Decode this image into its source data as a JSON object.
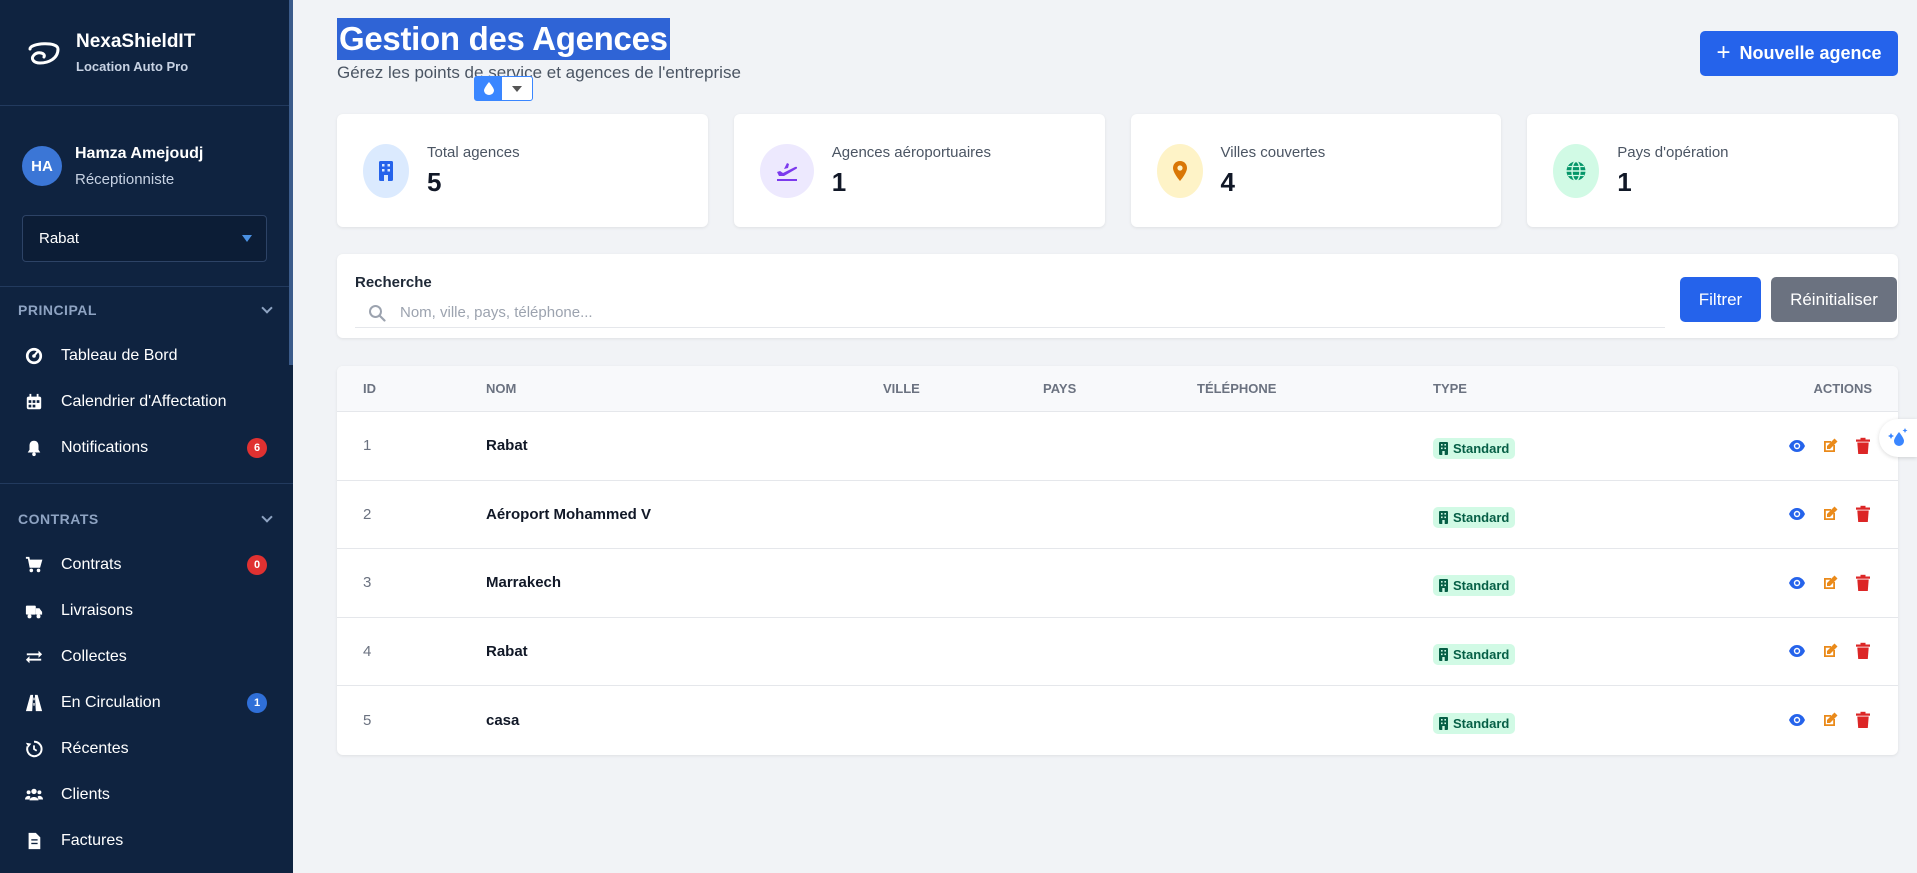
{
  "brand": {
    "name": "NexaShieldIT",
    "subtitle": "Location Auto Pro"
  },
  "user": {
    "initials": "HA",
    "name": "Hamza Amejoudj",
    "role": "Réceptionniste"
  },
  "branch": {
    "selected": "Rabat"
  },
  "sidebar": {
    "sections": [
      {
        "title": "PRINCIPAL",
        "items": [
          {
            "label": "Tableau de Bord",
            "icon": "gauge-icon"
          },
          {
            "label": "Calendrier d'Affectation",
            "icon": "calendar-icon"
          },
          {
            "label": "Notifications",
            "icon": "bell-icon",
            "badge": "6",
            "badge_color": "#e03131"
          }
        ]
      },
      {
        "title": "CONTRATS",
        "items": [
          {
            "label": "Contrats",
            "icon": "cart-icon",
            "badge": "0",
            "badge_color": "#e03131"
          },
          {
            "label": "Livraisons",
            "icon": "truck-icon"
          },
          {
            "label": "Collectes",
            "icon": "exchange-icon"
          },
          {
            "label": "En Circulation",
            "icon": "road-icon",
            "badge": "1",
            "badge_color": "#2f6fd8"
          },
          {
            "label": "Récentes",
            "icon": "history-icon"
          },
          {
            "label": "Clients",
            "icon": "users-icon"
          },
          {
            "label": "Factures",
            "icon": "invoice-icon"
          }
        ]
      }
    ]
  },
  "header": {
    "title": "Gestion des Agences",
    "subtitle": "Gérez les points de service et agences de l'entreprise",
    "new_button": "Nouvelle agence"
  },
  "stats": [
    {
      "label": "Total agences",
      "value": "5",
      "icon": "building-icon",
      "bg": "#dbeafe",
      "fg": "#2563eb"
    },
    {
      "label": "Agences aéroportuaires",
      "value": "1",
      "icon": "plane-icon",
      "bg": "#ede9fe",
      "fg": "#7c3aed"
    },
    {
      "label": "Villes couvertes",
      "value": "4",
      "icon": "map-pin-icon",
      "bg": "#fef3c7",
      "fg": "#d97706"
    },
    {
      "label": "Pays d'opération",
      "value": "1",
      "icon": "globe-icon",
      "bg": "#d1fae5",
      "fg": "#059669"
    }
  ],
  "search": {
    "label": "Recherche",
    "placeholder": "Nom, ville, pays, téléphone...",
    "filter_button": "Filtrer",
    "reset_button": "Réinitialiser"
  },
  "table": {
    "columns": {
      "id": "ID",
      "nom": "NOM",
      "ville": "VILLE",
      "pays": "PAYS",
      "telephone": "TÉLÉPHONE",
      "type": "TYPE",
      "actions": "ACTIONS"
    },
    "rows": [
      {
        "id": "1",
        "nom": "Rabat",
        "ville": "",
        "pays": "",
        "telephone": "",
        "type": "Standard"
      },
      {
        "id": "2",
        "nom": "Aéroport Mohammed V",
        "ville": "",
        "pays": "",
        "telephone": "",
        "type": "Standard"
      },
      {
        "id": "3",
        "nom": "Marrakech",
        "ville": "",
        "pays": "",
        "telephone": "",
        "type": "Standard"
      },
      {
        "id": "4",
        "nom": "Rabat",
        "ville": "",
        "pays": "",
        "telephone": "",
        "type": "Standard"
      },
      {
        "id": "5",
        "nom": "casa",
        "ville": "",
        "pays": "",
        "telephone": "",
        "type": "Standard"
      }
    ]
  },
  "colors": {
    "sidebar_bg": "#0f2340",
    "primary": "#2563eb",
    "secondary": "#6b7280",
    "view_action": "#2563eb",
    "edit_action": "#ea8a1a",
    "delete_action": "#dc2626"
  }
}
